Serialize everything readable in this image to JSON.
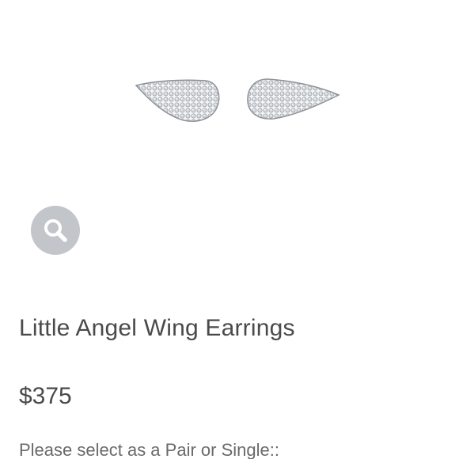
{
  "product": {
    "title": "Little Angel Wing Earrings",
    "price": "$375",
    "option_prompt": "Please select as a Pair or Single::",
    "image_icon": "angel-wing-earrings-image"
  },
  "zoom": {
    "icon": "magnifier-icon",
    "background_color": "#c2c5c9"
  }
}
